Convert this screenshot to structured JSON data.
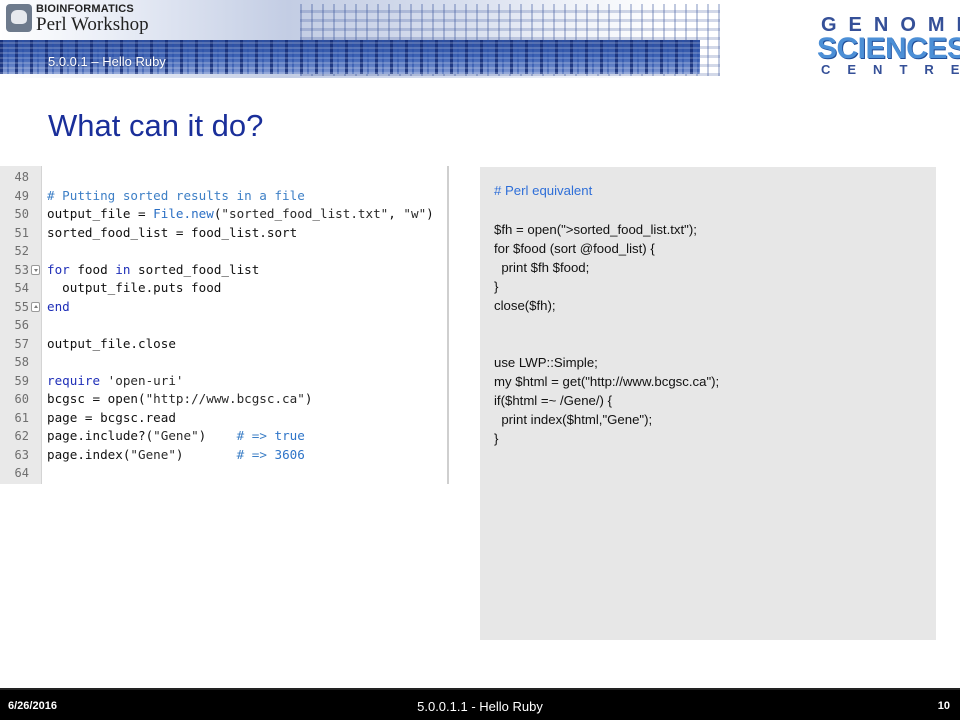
{
  "header": {
    "logo_top": "BIOINFORMATICS",
    "logo_main": "Perl Workshop",
    "subtitle": "5.0.0.1 – Hello Ruby",
    "gsc_genome": "GENOME",
    "gsc_sciences": "SCIENCES",
    "gsc_centre": "CENTRE"
  },
  "title": "What can it do?",
  "code_lines": [
    {
      "n": "48",
      "text": ""
    },
    {
      "n": "49",
      "text": "# Putting sorted results in a file"
    },
    {
      "n": "50",
      "text": "output_file = File.new(\"sorted_food_list.txt\", \"w\")"
    },
    {
      "n": "51",
      "text": "sorted_food_list = food_list.sort"
    },
    {
      "n": "52",
      "text": ""
    },
    {
      "n": "53",
      "text": "for food in sorted_food_list"
    },
    {
      "n": "54",
      "text": "  output_file.puts food"
    },
    {
      "n": "55",
      "text": "end"
    },
    {
      "n": "56",
      "text": ""
    },
    {
      "n": "57",
      "text": "output_file.close"
    },
    {
      "n": "58",
      "text": ""
    },
    {
      "n": "59",
      "text": "require 'open-uri'"
    },
    {
      "n": "60",
      "text": "bcgsc = open(\"http://www.bcgsc.ca\")"
    },
    {
      "n": "61",
      "text": "page = bcgsc.read"
    },
    {
      "n": "62",
      "text": "page.include?(\"Gene\")    # => true"
    },
    {
      "n": "63",
      "text": "page.index(\"Gene\")       # => 3606"
    },
    {
      "n": "64",
      "text": ""
    }
  ],
  "perl": {
    "comment": "# Perl equivalent",
    "block1": [
      "$fh = open(\">sorted_food_list.txt\");",
      "for $food (sort @food_list) {",
      "  print $fh $food;",
      "}",
      "close($fh);"
    ],
    "block2": [
      "use LWP::Simple;",
      "my $html = get(\"http://www.bcgsc.ca\");",
      "if($html =~ /Gene/) {",
      "  print index($html,\"Gene\");",
      "}"
    ]
  },
  "footer": {
    "date": "6/26/2016",
    "title": "5.0.0.1.1 - Hello Ruby",
    "page": "10"
  }
}
